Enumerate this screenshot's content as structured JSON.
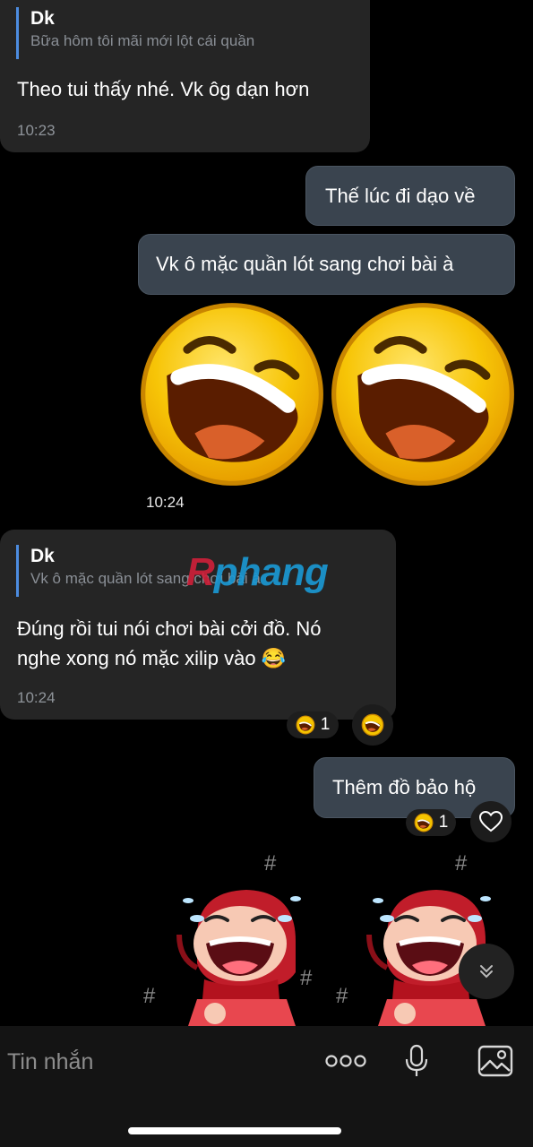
{
  "messages": [
    {
      "id": "m1",
      "reply_to": {
        "name": "Dk",
        "text": "Bữa hôm tôi mãi mới lột cái quần"
      },
      "text": "Theo tui thấy nhé. Vk ôg dạn hơn",
      "time": "10:23"
    },
    {
      "id": "m2",
      "text": "Thế lúc đi dạo về"
    },
    {
      "id": "m3",
      "text": "Vk ô mặc quần lót sang chơi bài à"
    },
    {
      "id": "m4",
      "sticker": "laughing-emoji-icon",
      "time": "10:24"
    },
    {
      "id": "m5",
      "reply_to": {
        "name": "Dk",
        "text": "Vk ô mặc quần lót sang chơi bài à"
      },
      "text_line1": "Đúng rồi  tui nói chơi bài cởi đồ. Nó",
      "text_line2": "nghe xong nó mặc xilip vào 😂",
      "time": "10:24",
      "reaction": {
        "icon": "laughing-emoji-icon",
        "count": "1"
      }
    },
    {
      "id": "m6",
      "text": "Thêm đồ bảo hộ",
      "reaction": {
        "icon": "laughing-emoji-icon",
        "count": "1"
      }
    }
  ],
  "watermark": {
    "text": "Rphang",
    "colors": {
      "R": "#d0203a",
      "rest": "#1a9ad6"
    }
  },
  "composer": {
    "placeholder": "Tin nhắn",
    "icons": [
      "more-dots-icon",
      "microphone-icon",
      "image-gallery-icon"
    ]
  },
  "controls": {
    "heart": "heart-icon",
    "scroll_down": "chevron-double-down-icon"
  },
  "colors": {
    "background": "#000000",
    "incoming_bubble": "#252525",
    "outgoing_bubble": "#3a444f",
    "quote_accent": "#4c8ce0",
    "emoji_yellow": "#f5c400"
  }
}
